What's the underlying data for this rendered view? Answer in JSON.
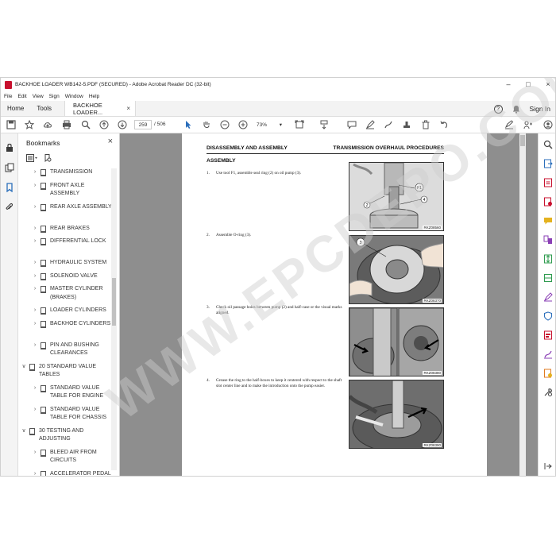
{
  "window": {
    "title": "BACKHOE LOADER WB142-5.PDF (SECURED) - Adobe Acrobat Reader DC (32-bit)",
    "controls": [
      "–",
      "□",
      "×"
    ]
  },
  "menu": [
    "File",
    "Edit",
    "View",
    "Sign",
    "Window",
    "Help"
  ],
  "tabs": {
    "home": "Home",
    "tools": "Tools",
    "document": "BACKHOE LOADER...",
    "close": "×",
    "help_icon": "?",
    "bell_icon": "bell",
    "sign_in": "Sign In"
  },
  "toolbar": {
    "page_current": "259",
    "page_total": "/ 506",
    "zoom": "73%",
    "zoom_caret": "▾"
  },
  "bookmarks": {
    "header": "Bookmarks",
    "close": "×",
    "items": [
      {
        "label": "TRANSMISSION",
        "level": 1
      },
      {
        "label": "FRONT AXLE ASSEMBLY",
        "level": 1
      },
      {
        "label": "REAR AXLE ASSEMBLY",
        "level": 1
      },
      {
        "label": "REAR BRAKES",
        "level": 1
      },
      {
        "label": "DIFFERENTIAL LOCK",
        "level": 1
      },
      {
        "label": "HYDRAULIC SYSTEM",
        "level": 1
      },
      {
        "label": "SOLENOID VALVE",
        "level": 1
      },
      {
        "label": "MASTER CYLINDER (BRAKES)",
        "level": 1
      },
      {
        "label": "LOADER CYLINDERS",
        "level": 1
      },
      {
        "label": "BACKHOE CYLINDERS",
        "level": 1
      },
      {
        "label": "PIN AND BUSHING CLEARANCES",
        "level": 1
      },
      {
        "label": "20 STANDARD VALUE TABLES",
        "level": 0
      },
      {
        "label": "STANDARD VALUE TABLE FOR ENGINE",
        "level": 1
      },
      {
        "label": "STANDARD VALUE TABLE FOR CHASSIS",
        "level": 1
      },
      {
        "label": "30 TESTING AND ADJUSTING",
        "level": 0
      },
      {
        "label": "BLEED AIR FROM CIRCUITS",
        "level": 1
      },
      {
        "label": "ACCELERATOR PEDAL AND THROTTLE LEVER",
        "level": 1
      }
    ]
  },
  "page": {
    "header_left": "DISASSEMBLY AND ASSEMBLY",
    "header_right": "TRANSMISSION OVERHAUL PROCEDURES",
    "section": "ASSEMBLY",
    "steps": [
      {
        "num": "1.",
        "text": "Use tool F1, assemble seal ring (2) on oil pump (3).",
        "caption": "RKZ08560",
        "callouts": [
          "F1",
          "2",
          "4"
        ]
      },
      {
        "num": "2.",
        "text": "Assemble O-ring (3).",
        "caption": "RKZ08370",
        "callouts": [
          "3"
        ]
      },
      {
        "num": "3.",
        "text": "Check oil passage holes between pump (2) and half-case or the visual marks aligned.",
        "caption": "RKZ08380",
        "callouts": []
      },
      {
        "num": "4.",
        "text": "Grease the ring to the half-boxes to keep it centered with respect to the shaft slot center line and to make the introduction onto the pump easier.",
        "caption": "RKZ08390",
        "callouts": []
      }
    ]
  },
  "watermark": "WWW.EPCDEPO.COM",
  "colors": {
    "acrobat_red": "#c8102e",
    "doc_background": "#8e8e8e",
    "tool_blue": "#2a6ebb",
    "tool_purple": "#8a3fb5",
    "tool_green": "#2e9b4e",
    "tool_orange": "#e07b20",
    "tool_yellow": "#e4b21f"
  }
}
